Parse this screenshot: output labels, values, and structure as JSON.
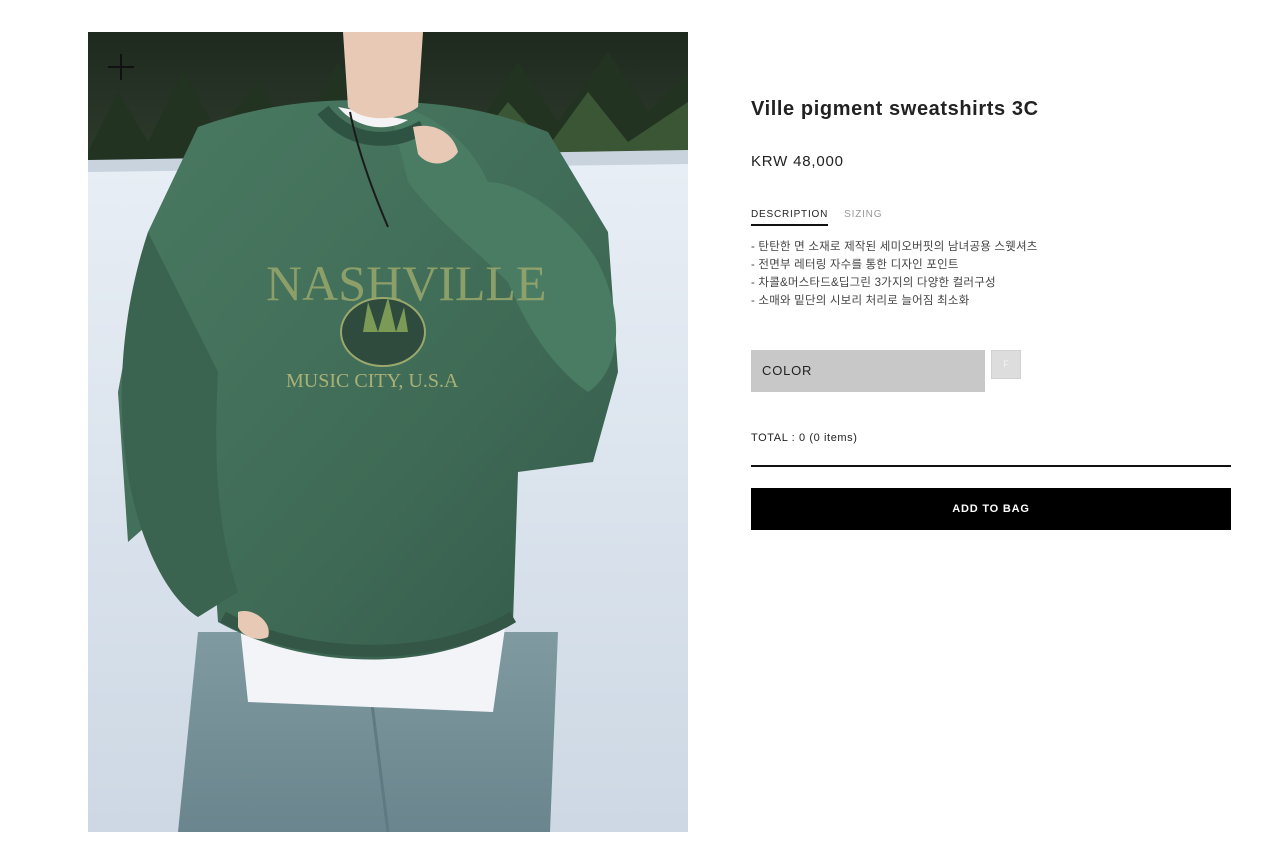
{
  "product": {
    "title": "Ville pigment sweatshirts 3C",
    "price": "KRW 48,000",
    "image_alt": "Model wearing green pigment-dyed sweatshirt with embroidered lettering on snowy field"
  },
  "tabs": [
    {
      "label": "DESCRIPTION",
      "active": true
    },
    {
      "label": "SIZING",
      "active": false
    }
  ],
  "description": [
    "- 탄탄한 면 소재로 제작된 세미오버핏의 남녀공용 스웻셔츠",
    "- 전면부 레터링 자수를 통한 디자인 포인트",
    "- 차콜&머스타드&딥그린 3가지의 다양한 컬러구성",
    "- 소매와 밑단의 시보리 처리로 늘어짐 최소화"
  ],
  "option": {
    "label": "COLOR",
    "swatch_text": "F"
  },
  "total": "TOTAL : 0 (0 items)",
  "add_to_bag": "ADD TO BAG",
  "print": {
    "line1": "NASHVILLE",
    "line2": "MUSIC CITY, U.S.A"
  },
  "colors": {
    "button_bg": "#000000",
    "option_bg": "#c8c8c8",
    "sweatshirt": "#3f6b56"
  },
  "icons": {
    "zoom": "plus-icon"
  }
}
